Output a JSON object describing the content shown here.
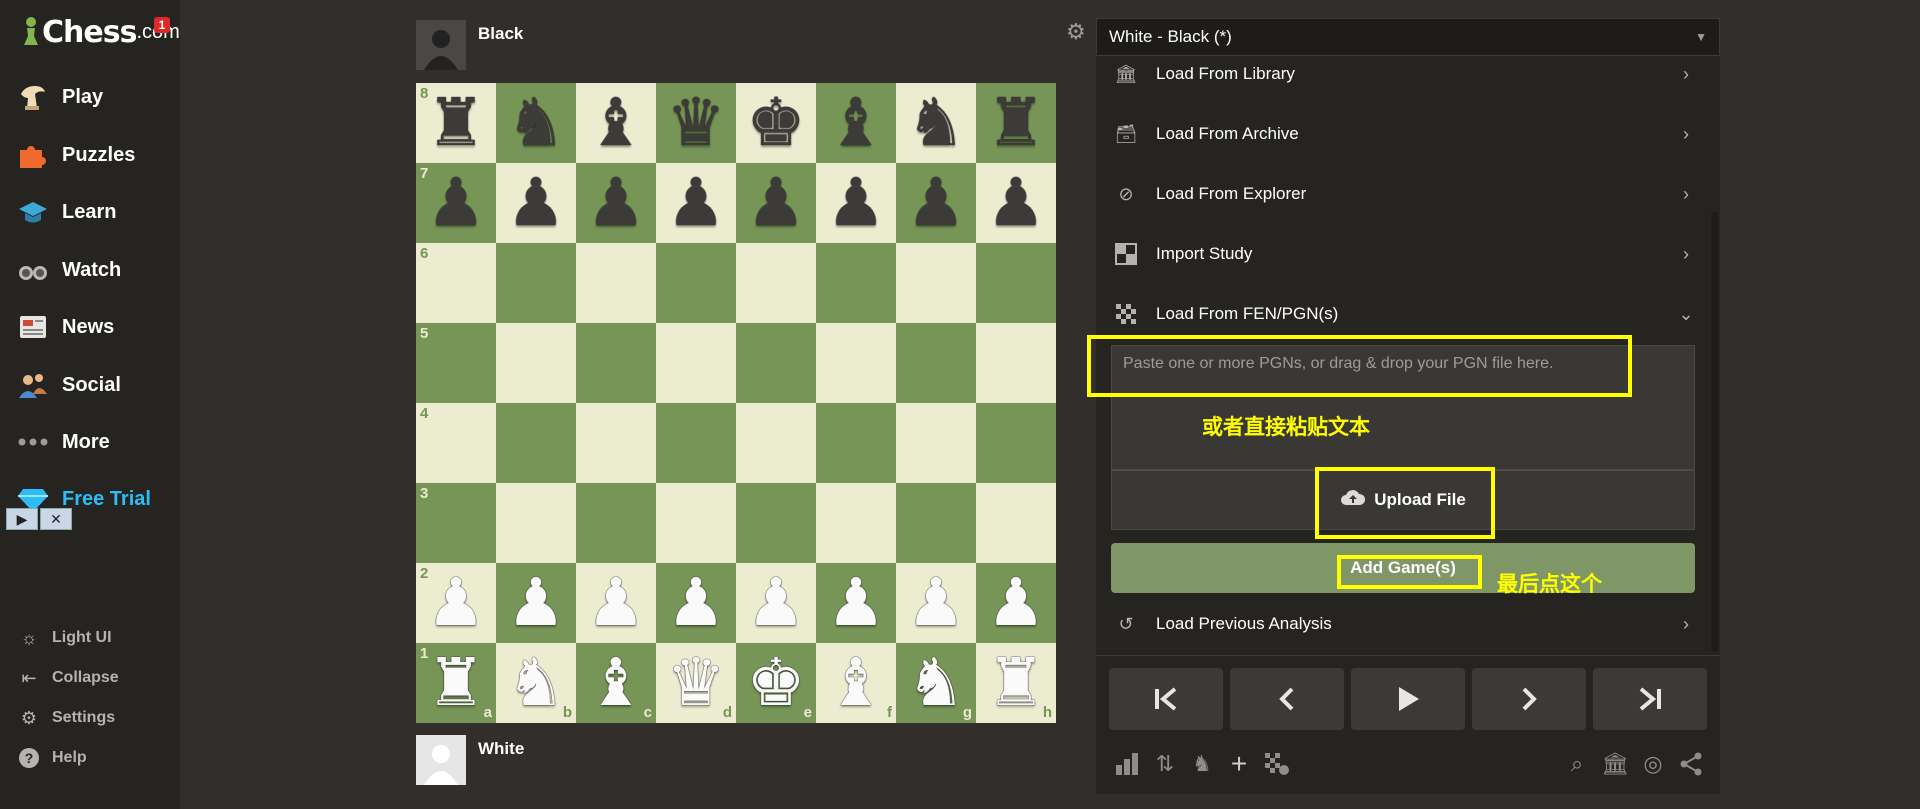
{
  "sidebar": {
    "logo_word": "Chess",
    "logo_suffix": ".com",
    "notification_count": "1",
    "nav": [
      {
        "label": "Play",
        "icon": "play-hand-icon"
      },
      {
        "label": "Puzzles",
        "icon": "puzzle-icon"
      },
      {
        "label": "Learn",
        "icon": "graduation-cap-icon"
      },
      {
        "label": "Watch",
        "icon": "binoculars-icon"
      },
      {
        "label": "News",
        "icon": "newspaper-icon"
      },
      {
        "label": "Social",
        "icon": "people-icon"
      },
      {
        "label": "More",
        "icon": "dots-icon"
      },
      {
        "label": "Free Trial",
        "icon": "diamond-icon"
      }
    ],
    "bottom": [
      {
        "label": "Light UI",
        "icon": "sun-icon"
      },
      {
        "label": "Collapse",
        "icon": "collapse-icon"
      },
      {
        "label": "Settings",
        "icon": "gear-icon"
      },
      {
        "label": "Help",
        "icon": "help-icon"
      }
    ]
  },
  "board": {
    "top_player": "Black",
    "bottom_player": "White",
    "ranks": [
      "8",
      "7",
      "6",
      "5",
      "4",
      "3",
      "2",
      "1"
    ],
    "files": [
      "a",
      "b",
      "c",
      "d",
      "e",
      "f",
      "g",
      "h"
    ],
    "position": [
      [
        "r",
        "n",
        "b",
        "q",
        "k",
        "b",
        "n",
        "r"
      ],
      [
        "p",
        "p",
        "p",
        "p",
        "p",
        "p",
        "p",
        "p"
      ],
      [
        "",
        "",
        "",
        "",
        "",
        "",
        "",
        ""
      ],
      [
        "",
        "",
        "",
        "",
        "",
        "",
        "",
        ""
      ],
      [
        "",
        "",
        "",
        "",
        "",
        "",
        "",
        ""
      ],
      [
        "",
        "",
        "",
        "",
        "",
        "",
        "",
        ""
      ],
      [
        "P",
        "P",
        "P",
        "P",
        "P",
        "P",
        "P",
        "P"
      ],
      [
        "R",
        "N",
        "B",
        "Q",
        "K",
        "B",
        "N",
        "R"
      ]
    ],
    "light_color": "#ebecd0",
    "dark_color": "#779556"
  },
  "panel": {
    "game_title": "White - Black (*)",
    "menu": [
      {
        "label": "Load From Library",
        "icon": "library-icon"
      },
      {
        "label": "Load From Archive",
        "icon": "archive-icon"
      },
      {
        "label": "Load From Explorer",
        "icon": "compass-icon"
      },
      {
        "label": "Import Study",
        "icon": "study-icon"
      },
      {
        "label": "Load From FEN/PGN(s)",
        "icon": "board-grid-icon"
      }
    ],
    "pgn_placeholder": "Paste one or more PGNs, or drag & drop your PGN file here.",
    "pgn_value": "",
    "upload_label": "Upload File",
    "add_label": "Add Game(s)",
    "previous_analysis": "Load Previous Analysis"
  },
  "annotations": {
    "paste_text": "或者直接粘贴文本",
    "click_last": "最后点这个",
    "color": "#ffff00"
  }
}
